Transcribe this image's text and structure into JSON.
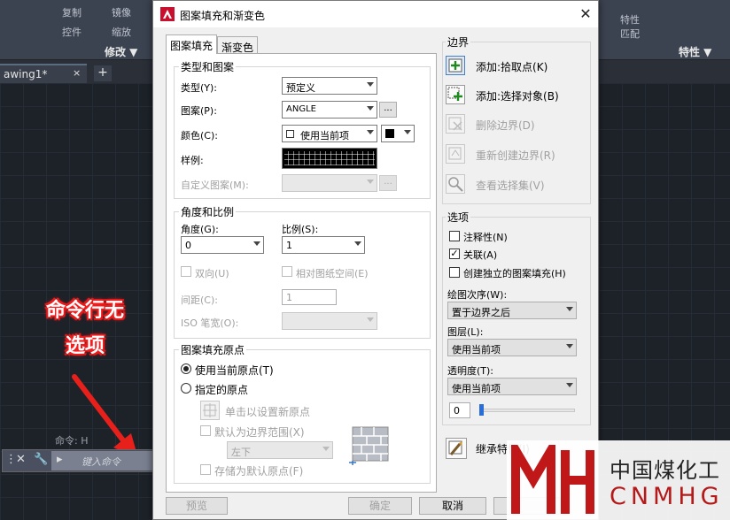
{
  "background": {
    "ribbon_items": [
      "复制",
      "镜像",
      "控件",
      "缩放"
    ],
    "panel_modify": "修改 ▼",
    "panel_properties": "特性 ▼",
    "ribbon_right_a": "特性",
    "ribbon_right_b": "匹配",
    "doc_tab": "awing1*",
    "doc_tab_close": "×",
    "doc_tab_add": "+",
    "cmd_history": "命令: H",
    "cmd_placeholder": "键入命令",
    "annotation_line1": "命令行无",
    "annotation_line2": "选项",
    "watermark_cn": "中国煤化工",
    "watermark_en": "CNMHG"
  },
  "dialog": {
    "title": "图案填充和渐变色",
    "close": "✕",
    "tabs": [
      "图案填充",
      "渐变色"
    ],
    "type_pattern": {
      "group": "类型和图案",
      "type_label": "类型(Y):",
      "type_value": "预定义",
      "pattern_label": "图案(P):",
      "pattern_value": "ANGLE",
      "color_label": "颜色(C):",
      "color_value": "使用当前项",
      "swatch_label": "样例:",
      "custom_label": "自定义图案(M):",
      "ellipsis": "..."
    },
    "angle_scale": {
      "group": "角度和比例",
      "angle_label": "角度(G):",
      "angle_value": "0",
      "scale_label": "比例(S):",
      "scale_value": "1",
      "double_label": "双向(U)",
      "relative_label": "相对图纸空间(E)",
      "spacing_label": "间距(C):",
      "spacing_value": "1",
      "iso_label": "ISO 笔宽(O):"
    },
    "origin": {
      "group": "图案填充原点",
      "use_current": "使用当前原点(T)",
      "specified": "指定的原点",
      "click_set": "单击以设置新原点",
      "default_extent": "默认为边界范围(X)",
      "extent_value": "左下",
      "store_default": "存储为默认原点(F)"
    },
    "boundary": {
      "group": "边界",
      "add_pick": "添加:拾取点(K)",
      "add_select": "添加:选择对象(B)",
      "remove": "删除边界(D)",
      "recreate": "重新创建边界(R)",
      "view": "查看选择集(V)"
    },
    "options": {
      "group": "选项",
      "annotative": "注释性(N)",
      "associative": "关联(A)",
      "separate": "创建独立的图案填充(H)",
      "draw_order_label": "绘图次序(W):",
      "draw_order_value": "置于边界之后",
      "layer_label": "图层(L):",
      "layer_value": "使用当前项",
      "transparency_label": "透明度(T):",
      "transparency_value": "使用当前项",
      "transparency_amount": "0"
    },
    "inherit": "继承特性(I)",
    "footer": {
      "preview": "预览",
      "ok": "确定",
      "cancel": "取消"
    }
  }
}
